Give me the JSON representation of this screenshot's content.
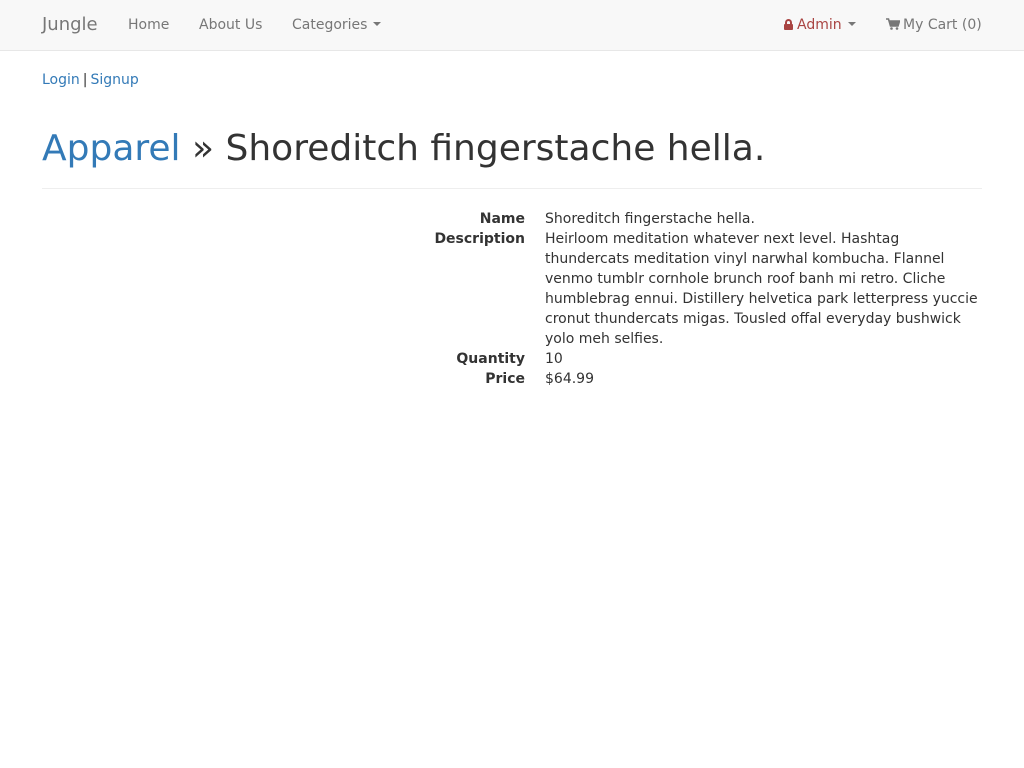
{
  "navbar": {
    "brand": "Jungle",
    "home": "Home",
    "about": "About Us",
    "categories": "Categories",
    "admin": "Admin",
    "cart": "My Cart (0)"
  },
  "auth": {
    "login": "Login",
    "separator": "|",
    "signup": "Signup"
  },
  "header": {
    "category": "Apparel",
    "separator": "»",
    "product_name": "Shoreditch fingerstache hella."
  },
  "product": {
    "name_label": "Name",
    "name_value": "Shoreditch fingerstache hella.",
    "description_label": "Description",
    "description_value": "Heirloom meditation whatever next level. Hashtag thundercats meditation vinyl narwhal kombucha. Flannel venmo tumblr cornhole brunch roof banh mi retro. Cliche humblebrag ennui. Distillery helvetica park letterpress yuccie cronut thundercats migas. Tousled offal everyday bushwick yolo meh selfies.",
    "quantity_label": "Quantity",
    "quantity_value": "10",
    "price_label": "Price",
    "price_value": "$64.99"
  },
  "icons": {
    "admin": "lock-icon",
    "cart": "shopping-cart-icon",
    "dropdown": "caret-down-icon"
  },
  "colors": {
    "link": "#337ab7",
    "admin": "#a94442",
    "nav_text": "#777777",
    "navbar_bg": "#f8f8f8"
  }
}
